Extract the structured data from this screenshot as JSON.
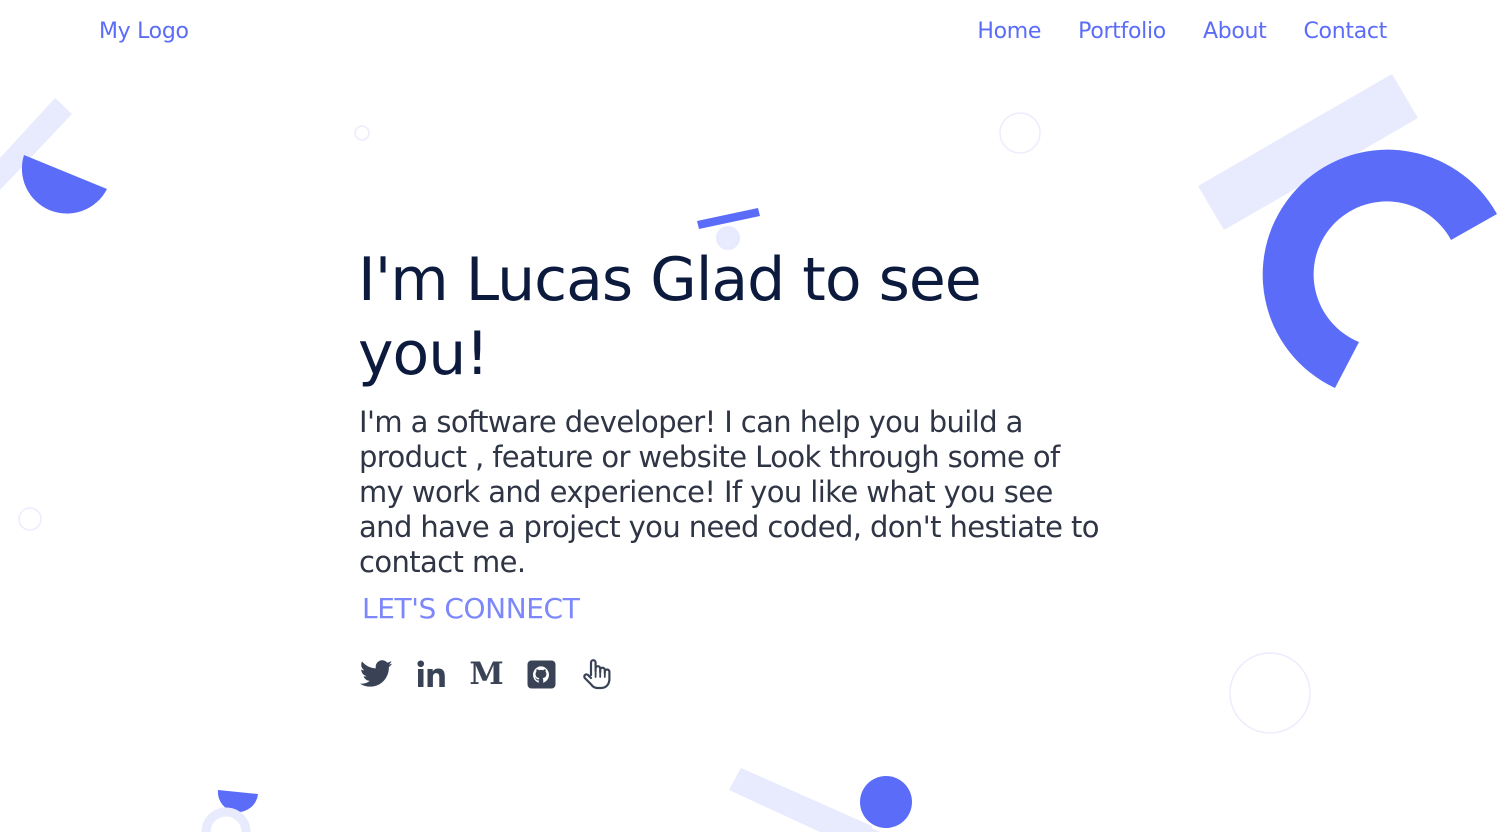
{
  "header": {
    "logo": "My Logo",
    "nav": [
      "Home",
      "Portfolio",
      "About",
      "Contact"
    ]
  },
  "hero": {
    "title": "I'm Lucas Glad to see you!",
    "description": "I'm a software developer! I can help you build a product , feature or website Look through some of my work and experience! If you like what you see and have a project you need coded, don't hestiate to contact me.",
    "connect_label": "LET'S CONNECT"
  },
  "socials": [
    "twitter-icon",
    "linkedin-icon",
    "medium-icon",
    "github-icon",
    "hand-pointer-icon"
  ],
  "colors": {
    "accent": "#5b6cf9",
    "accent_light": "#e8eafd",
    "heading": "#0c1a3e",
    "body_text": "#2f3545",
    "connect": "#7b87fb",
    "icon": "#3a4356"
  }
}
